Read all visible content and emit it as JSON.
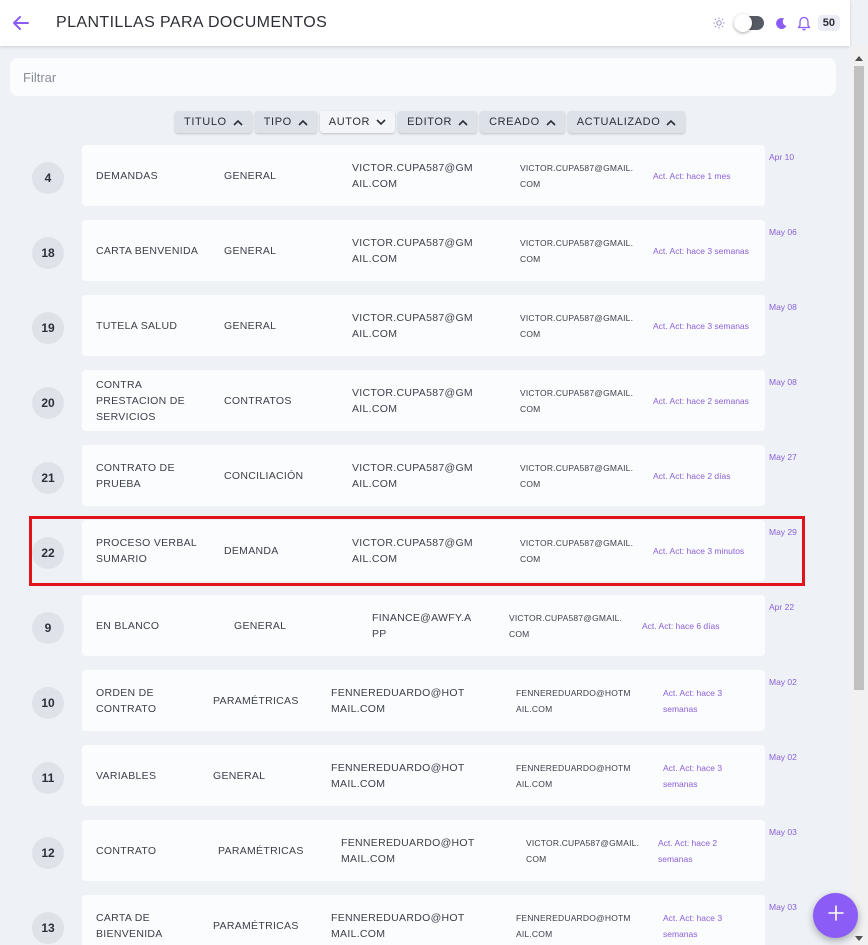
{
  "header": {
    "title": "PLANTILLAS PARA DOCUMENTOS",
    "notification_count": "50"
  },
  "filter": {
    "placeholder": "Filtrar",
    "value": ""
  },
  "sort_buttons": [
    {
      "label": "TITULO",
      "direction": "up"
    },
    {
      "label": "TIPO",
      "direction": "up"
    },
    {
      "label": "AUTOR",
      "direction": "down"
    },
    {
      "label": "EDITOR",
      "direction": "up"
    },
    {
      "label": "CREADO",
      "direction": "up"
    },
    {
      "label": "ACTUALIZADO",
      "direction": "up"
    }
  ],
  "rows": [
    {
      "id": "4",
      "title": "DEMANDAS",
      "type": "GENERAL",
      "author": "VICTOR.CUPA587@GMAIL.COM",
      "editor": "VICTOR.CUPA587@GMAIL.COM",
      "updated": "Act. Act: hace 1 mes",
      "date": "Apr 10"
    },
    {
      "id": "18",
      "title": "CARTA BENVENIDA",
      "type": "GENERAL",
      "author": "VICTOR.CUPA587@GMAIL.COM",
      "editor": "VICTOR.CUPA587@GMAIL.COM",
      "updated": "Act. Act: hace 3 semanas",
      "date": "May 06"
    },
    {
      "id": "19",
      "title": "TUTELA SALUD",
      "type": "GENERAL",
      "author": "VICTOR.CUPA587@GMAIL.COM",
      "editor": "VICTOR.CUPA587@GMAIL.COM",
      "updated": "Act. Act: hace 3 semanas",
      "date": "May 08"
    },
    {
      "id": "20",
      "title": "CONTRA PRESTACION DE SERVICIOS",
      "type": "CONTRATOS",
      "author": "VICTOR.CUPA587@GMAIL.COM",
      "editor": "VICTOR.CUPA587@GMAIL.COM",
      "updated": "Act. Act: hace 2 semanas",
      "date": "May 08"
    },
    {
      "id": "21",
      "title": "CONTRATO DE PRUEBA",
      "type": "CONCILIACIÓN",
      "author": "VICTOR.CUPA587@GMAIL.COM",
      "editor": "VICTOR.CUPA587@GMAIL.COM",
      "updated": "Act. Act: hace 2 días",
      "date": "May 27"
    },
    {
      "id": "22",
      "title": "PROCESO VERBAL SUMARIO",
      "type": "DEMANDA",
      "author": "VICTOR.CUPA587@GMAIL.COM",
      "editor": "VICTOR.CUPA587@GMAIL.COM",
      "updated": "Act. Act: hace 3 minutos",
      "date": "May 29"
    },
    {
      "id": "9",
      "title": "EN BLANCO",
      "type": "GENERAL",
      "author": "FINANCE@AWFY.APP",
      "editor": "VICTOR.CUPA587@GMAIL.COM",
      "updated": "Act. Act: hace 6 días",
      "date": "Apr 22"
    },
    {
      "id": "10",
      "title": "ORDEN DE CONTRATO",
      "type": "PARAMÉTRICAS",
      "author": "FENNEREDUARDO@HOTMAIL.COM",
      "editor": "FENNEREDUARDO@HOTMAIL.COM",
      "updated": "Act. Act: hace 3 semanas",
      "date": "May 02"
    },
    {
      "id": "11",
      "title": "VARIABLES",
      "type": "GENERAL",
      "author": "FENNEREDUARDO@HOTMAIL.COM",
      "editor": "FENNEREDUARDO@HOTMAIL.COM",
      "updated": "Act. Act: hace 3 semanas",
      "date": "May 02"
    },
    {
      "id": "12",
      "title": "CONTRATO",
      "type": "PARAMÉTRICAS",
      "author": "FENNEREDUARDO@HOTMAIL.COM",
      "editor": "VICTOR.CUPA587@GMAIL.COM",
      "updated": "Act. Act: hace 2 semanas",
      "date": "May 03"
    },
    {
      "id": "13",
      "title": "CARTA DE BIENVENIDA",
      "type": "PARAMÉTRICAS",
      "author": "FENNEREDUARDO@HOTMAIL.COM",
      "editor": "FENNEREDUARDO@HOTMAIL.COM",
      "updated": "Act. Act: hace 3 semanas",
      "date": "May 03"
    }
  ],
  "colors": {
    "accent": "#8b5cf6",
    "highlight": "#e3131b",
    "updated_text": "#8a5fd8"
  },
  "icons": [
    "back-arrow-icon",
    "sun-icon",
    "moon-icon",
    "bell-icon",
    "chevron-up-icon",
    "chevron-down-icon",
    "plus-icon"
  ]
}
